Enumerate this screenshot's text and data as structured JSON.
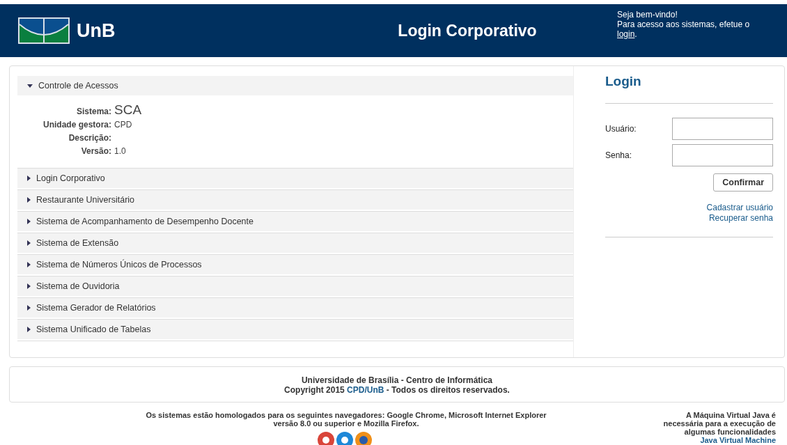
{
  "header": {
    "logo_text": "UnB",
    "title": "Login Corporativo",
    "welcome": "Seja bem-vindo!",
    "welcome_line": "Para acesso aos sistemas, efetue o",
    "welcome_link": "login",
    "welcome_end": "."
  },
  "systems": [
    {
      "title": "Controle de Acessos",
      "expanded": true,
      "details": [
        {
          "label": "Sistema:",
          "value": "SCA",
          "kind": "large"
        },
        {
          "label": "Unidade gestora:",
          "value": "CPD",
          "kind": "normal"
        },
        {
          "label": "Descrição:",
          "kind": "normal"
        },
        {
          "label": "Versão:",
          "value": "1.0",
          "kind": "normal"
        }
      ]
    },
    {
      "title": "Login Corporativo",
      "expanded": false
    },
    {
      "title": "Restaurante Universitário",
      "expanded": false
    },
    {
      "title": "Sistema de Acompanhamento de Desempenho Docente",
      "expanded": false
    },
    {
      "title": "Sistema de Extensão",
      "expanded": false
    },
    {
      "title": "Sistema de Números Únicos de Processos",
      "expanded": false
    },
    {
      "title": "Sistema de Ouvidoria",
      "expanded": false
    },
    {
      "title": "Sistema Gerador de Relatórios",
      "expanded": false
    },
    {
      "title": "Sistema Unificado de Tabelas",
      "expanded": false
    }
  ],
  "login": {
    "title": "Login",
    "fields": [
      {
        "label": "Usuário:"
      },
      {
        "label": "Senha:"
      }
    ],
    "button": "Confirmar",
    "links": [
      "Cadastrar usuário",
      "Recuperar senha"
    ]
  },
  "footer": {
    "line1": "Universidade de Brasília - Centro de Informática",
    "line2_start": "Copyright 2015",
    "line2_link": "CPD/UnB",
    "line2_end": "- Todos os direitos reservados."
  },
  "browsers": {
    "line1": "Os sistemas estão homologados para os seguintes navegadores: Google Chrome, Microsoft Internet Explorer",
    "line2": "versão 8.0 ou superior e Mozilla Firefox."
  },
  "java": {
    "lines": [
      "A Máquina Virtual Java é",
      "necessária para a execução de",
      "algumas funcionalidades"
    ],
    "link": "Java Virtual Machine"
  }
}
